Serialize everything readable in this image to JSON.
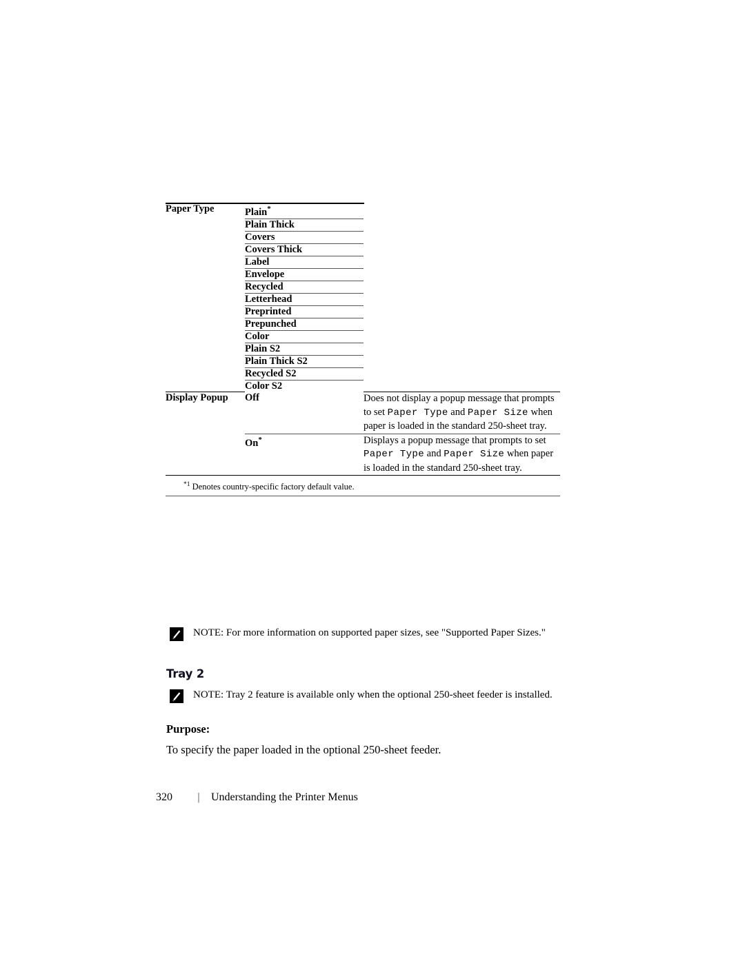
{
  "document": {
    "page_number": "320",
    "footer_separator": "|",
    "footer_title": "Understanding the Printer Menus"
  },
  "table": {
    "paper_type": {
      "item_label": "Paper Type",
      "values": [
        {
          "label": "Plain",
          "default_marker": "*"
        },
        {
          "label": "Plain Thick",
          "default_marker": ""
        },
        {
          "label": "Covers",
          "default_marker": ""
        },
        {
          "label": "Covers Thick",
          "default_marker": ""
        },
        {
          "label": "Label",
          "default_marker": ""
        },
        {
          "label": "Envelope",
          "default_marker": ""
        },
        {
          "label": "Recycled",
          "default_marker": ""
        },
        {
          "label": "Letterhead",
          "default_marker": ""
        },
        {
          "label": "Preprinted",
          "default_marker": ""
        },
        {
          "label": "Prepunched",
          "default_marker": ""
        },
        {
          "label": "Color",
          "default_marker": ""
        },
        {
          "label": "Plain S2",
          "default_marker": ""
        },
        {
          "label": "Plain Thick S2",
          "default_marker": ""
        },
        {
          "label": "Recycled S2",
          "default_marker": ""
        },
        {
          "label": "Color S2",
          "default_marker": ""
        }
      ]
    },
    "display_popup": {
      "item_label": "Display Popup",
      "rows": [
        {
          "value": "Off",
          "default_marker": "",
          "description_parts": [
            {
              "text": "Does not display a popup message that prompts to set ",
              "style": "normal"
            },
            {
              "text": "Paper Type",
              "style": "mono"
            },
            {
              "text": " and ",
              "style": "normal"
            },
            {
              "text": "Paper Size",
              "style": "mono"
            },
            {
              "text": " when paper is loaded in the standard 250-sheet tray.",
              "style": "normal"
            }
          ]
        },
        {
          "value": "On",
          "default_marker": "*",
          "description_parts": [
            {
              "text": "Displays a popup message that prompts to set ",
              "style": "normal"
            },
            {
              "text": "Paper Type",
              "style": "mono"
            },
            {
              "text": " and ",
              "style": "normal"
            },
            {
              "text": "Paper Size",
              "style": "mono"
            },
            {
              "text": " when paper is loaded in the standard 250-sheet tray.",
              "style": "normal"
            }
          ]
        }
      ]
    },
    "footnote": {
      "marker": "*1",
      "text": " Denotes country-specific factory default value."
    }
  },
  "notes": {
    "supported_sizes": "NOTE: For more information on supported paper sizes, see \"Supported Paper Sizes.\"",
    "tray2": "NOTE: Tray 2 feature is available only when the optional 250-sheet feeder is installed."
  },
  "headings": {
    "tray2": "Tray 2",
    "purpose": "Purpose:"
  },
  "body": {
    "purpose_text": "To specify the paper loaded in the optional 250-sheet feeder."
  },
  "colors": {
    "text": "#000000",
    "rule_heavy": "#000000",
    "rule_light": "#555555",
    "heading_accent": "#111122"
  }
}
